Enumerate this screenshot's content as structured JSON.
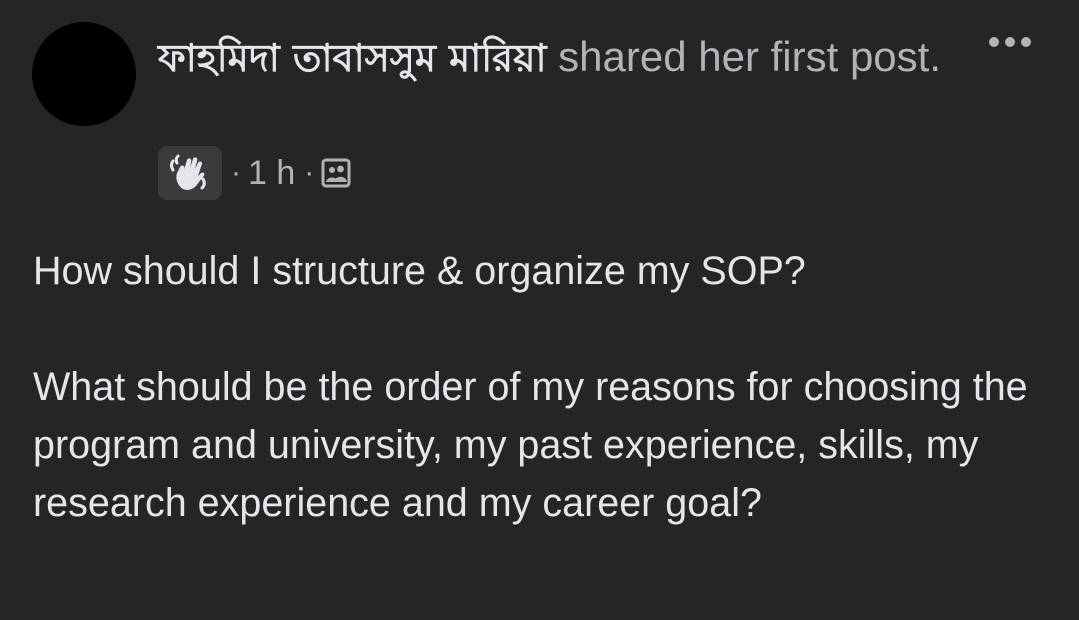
{
  "post": {
    "author": "ফাহমিদা তাবাসসুম মারিয়া",
    "action": " shared her first post.",
    "time": "1 h",
    "separator": "·",
    "badge_icon": "waving-hand-icon",
    "audience_icon": "group-icon",
    "more_icon": "more-options-icon",
    "body_question": "How should I structure & organize my SOP?",
    "body_detail": "What should be the order of my reasons for choosing the program and university, my past experience, skills, my research experience and my career goal?"
  },
  "colors": {
    "background": "#242526",
    "primary_text": "#e4e6eb",
    "secondary_text": "#b0b3b8",
    "badge_background": "#3a3b3c"
  }
}
